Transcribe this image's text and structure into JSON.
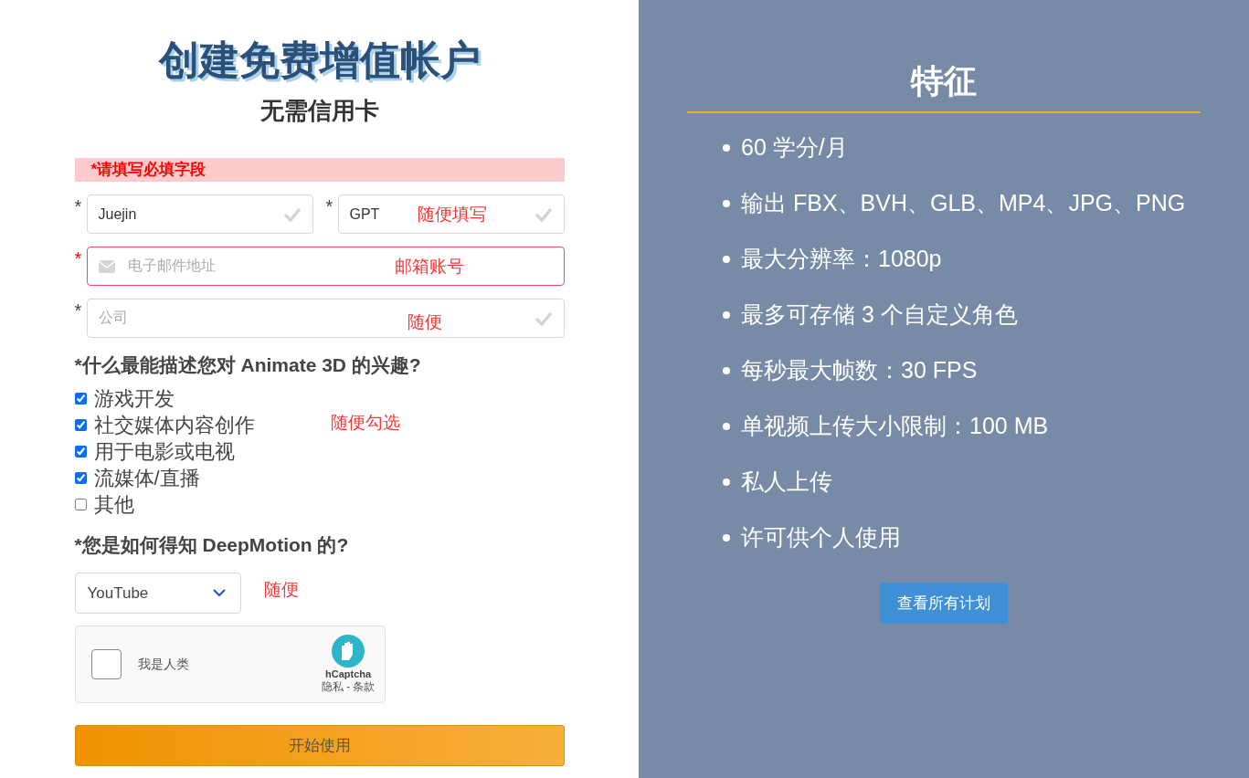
{
  "signup": {
    "title": "创建免费增值帐户",
    "subtitle": "无需信用卡",
    "error_banner": "*请填写必填字段",
    "name_fields": [
      {
        "required_mark": "*",
        "value": "Juejin",
        "valid": true
      },
      {
        "required_mark": "*",
        "value": "GPT",
        "valid": true,
        "annotation": "随便填写"
      }
    ],
    "email_field": {
      "required_mark": "*",
      "placeholder": "电子邮件地址",
      "invalid": true,
      "annotation": "邮箱账号"
    },
    "company_field": {
      "required_mark": "*",
      "placeholder": "公司",
      "valid": true,
      "annotation": "随便"
    },
    "interest_question": "*什么最能描述您对 Animate 3D 的兴趣?",
    "interests": [
      {
        "label": "游戏开发",
        "checked": true
      },
      {
        "label": "社交媒体内容创作",
        "checked": true
      },
      {
        "label": "用于电影或电视",
        "checked": true
      },
      {
        "label": "流媒体/直播",
        "checked": true
      },
      {
        "label": "其他",
        "checked": false
      }
    ],
    "interests_annotation": "随便勾选",
    "source_question": "*您是如何得知 DeepMotion 的?",
    "source_select": {
      "value": "YouTube",
      "annotation": "随便"
    },
    "captcha": {
      "label": "我是人类",
      "checked": false,
      "brand": "hCaptcha",
      "links": "隐私 - 条款"
    },
    "submit": "开始使用"
  },
  "features": {
    "title": "特征",
    "items": [
      "60 学分/月",
      "输出 FBX、BVH、GLB、MP4、JPG、PNG",
      "最大分辨率：1080p",
      "最多可存储 3 个自定义角色",
      "每秒最大帧数：30 FPS",
      "单视频上传大小限制：100 MB",
      "私人上传",
      "许可供个人使用"
    ],
    "button": "查看所有计划"
  }
}
